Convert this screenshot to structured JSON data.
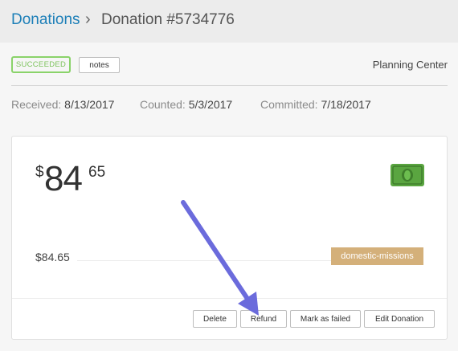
{
  "breadcrumb": {
    "parent": "Donations",
    "separator": "›",
    "current": "Donation #5734776"
  },
  "status": {
    "badge": "SUCCEEDED",
    "notes_label": "notes",
    "organization": "Planning Center"
  },
  "dates": {
    "received_label": "Received:",
    "received_value": "8/13/2017",
    "counted_label": "Counted:",
    "counted_value": "5/3/2017",
    "committed_label": "Committed:",
    "committed_value": "7/18/2017"
  },
  "donation": {
    "currency_symbol": "$",
    "amount_dollars": "84",
    "amount_cents": "65",
    "payment_icon": "cash-icon",
    "fund_amount": "$84.65",
    "fund_name": "domestic-missions"
  },
  "actions": {
    "delete": "Delete",
    "refund": "Refund",
    "mark_failed": "Mark as failed",
    "edit": "Edit Donation"
  },
  "colors": {
    "link": "#1d7fb8",
    "success": "#8ad36a",
    "fund_tag": "#d4b07a",
    "cash_green": "#5aa540",
    "annotation_arrow": "#6b6bdc"
  }
}
